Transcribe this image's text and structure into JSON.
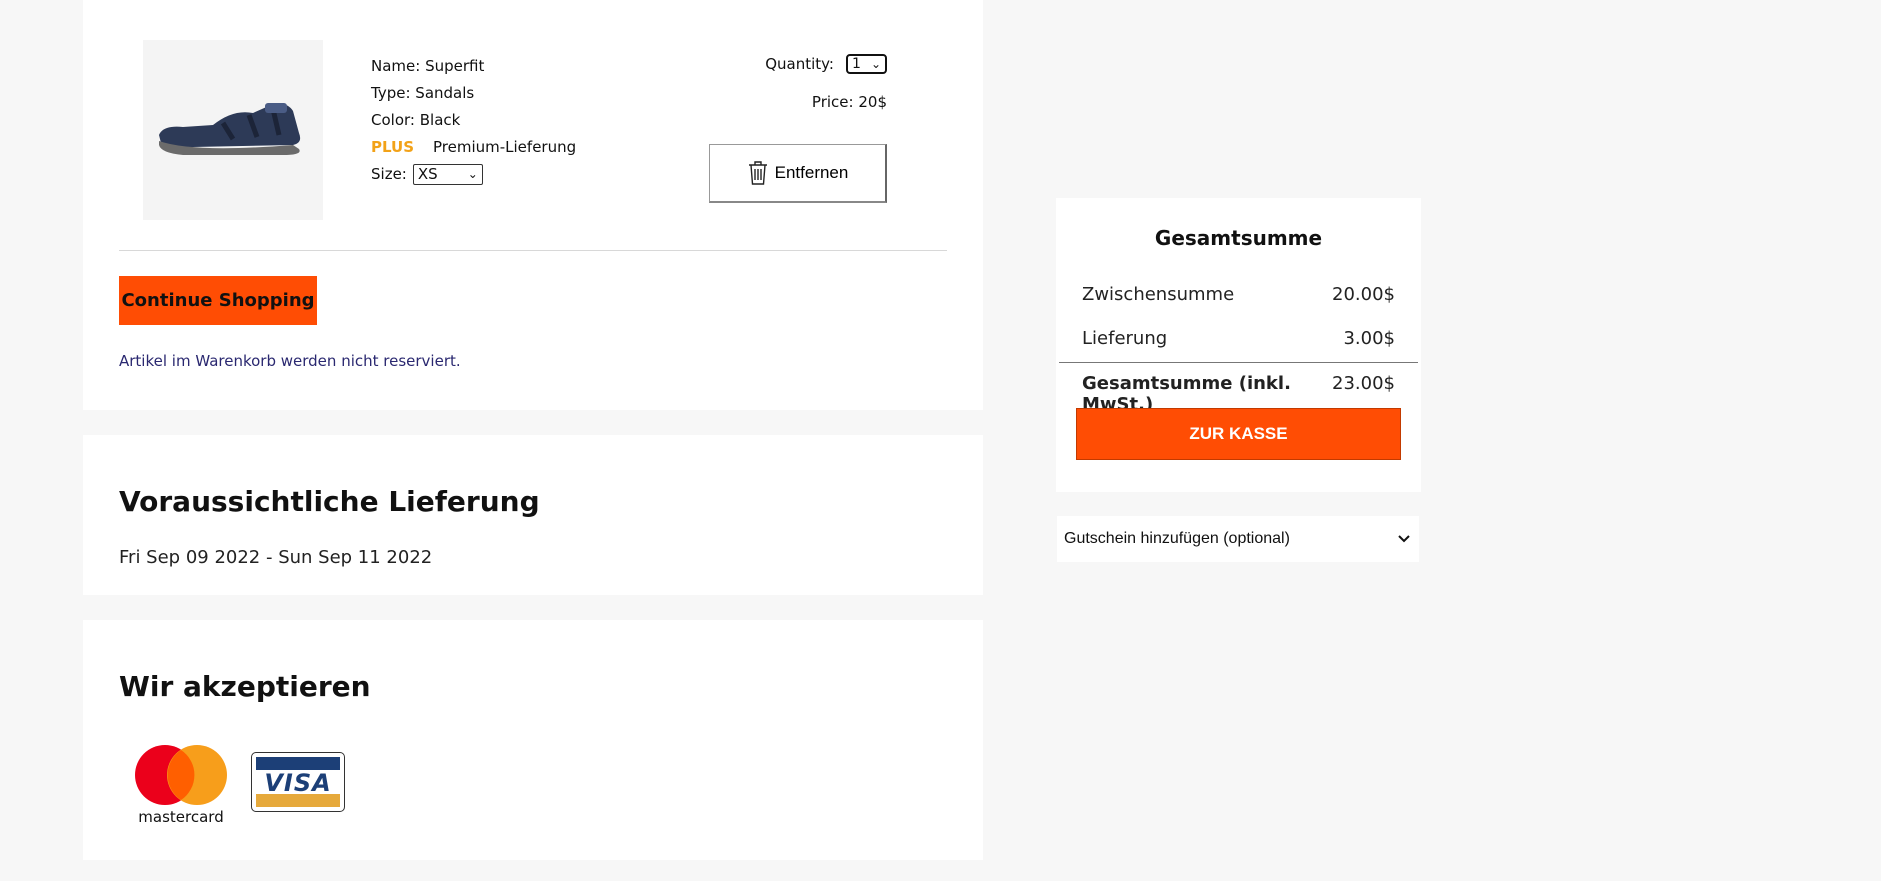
{
  "cart": {
    "item": {
      "image_alt": "sandal",
      "name_label": "Name:",
      "name": "Superfit",
      "type_label": "Type:",
      "type": "Sandals",
      "color_label": "Color:",
      "color": "Black",
      "plus_label": "PLUS",
      "premium": "Premium-Lieferung",
      "size_label": "Size:",
      "size_value": "XS",
      "quantity_label": "Quantity:",
      "quantity_value": "1",
      "price_label": "Price:",
      "price": "20$",
      "remove_label": "Entfernen"
    },
    "continue_label": "Continue Shopping",
    "note": "Artikel im Warenkorb werden nicht reserviert."
  },
  "delivery": {
    "title": "Voraussichtliche Lieferung",
    "date_range": "Fri Sep 09 2022 - Sun Sep 11 2022"
  },
  "payment": {
    "title": "Wir akzeptieren",
    "methods": [
      "mastercard",
      "VISA"
    ]
  },
  "summary": {
    "title": "Gesamtsumme",
    "subtotal_label": "Zwischensumme",
    "subtotal": "20.00$",
    "shipping_label": "Lieferung",
    "shipping": "3.00$",
    "total_label": "Gesamtsumme (inkl. MwSt.)",
    "total": "23.00$",
    "checkout_label": "ZUR KASSE"
  },
  "coupon": {
    "label": "Gutschein hinzufügen (optional)"
  },
  "colors": {
    "accent": "#ff4d04",
    "plus": "#f2a218",
    "note": "#2a2870",
    "background": "#f7f7f7"
  }
}
